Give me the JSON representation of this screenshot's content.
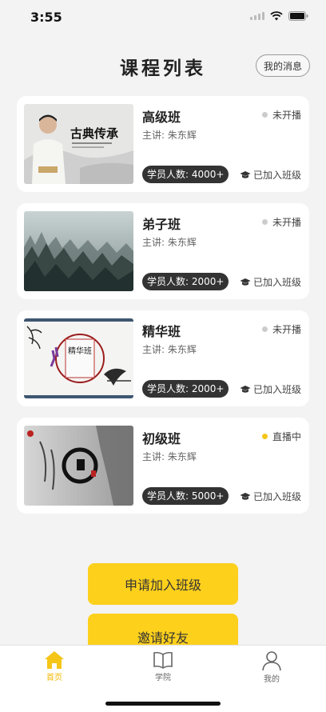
{
  "status_bar": {
    "time": "3:55"
  },
  "header": {
    "title": "课程列表",
    "messages_label": "我的消息"
  },
  "courses": [
    {
      "name": "高级班",
      "teacher": "主讲: 朱东辉",
      "status": "未开播",
      "live": false,
      "students": "学员人数: 4000+",
      "joined": "已加入班级",
      "thumb_caption": "古典传承"
    },
    {
      "name": "弟子班",
      "teacher": "主讲: 朱东辉",
      "status": "未开播",
      "live": false,
      "students": "学员人数: 2000+",
      "joined": "已加入班级"
    },
    {
      "name": "精华班",
      "teacher": "主讲: 朱东辉",
      "status": "未开播",
      "live": false,
      "students": "学员人数: 2000+",
      "joined": "已加入班级",
      "thumb_caption": "精华班"
    },
    {
      "name": "初级班",
      "teacher": "主讲: 朱东辉",
      "status": "直播中",
      "live": true,
      "students": "学员人数: 5000+",
      "joined": "已加入班级"
    }
  ],
  "actions": {
    "apply_label": "申请加入班级",
    "invite_label": "邀请好友"
  },
  "tabs": [
    {
      "label": "首页",
      "icon": "home-icon",
      "active": true
    },
    {
      "label": "学院",
      "icon": "book-icon",
      "active": false
    },
    {
      "label": "我的",
      "icon": "person-icon",
      "active": false
    }
  ],
  "colors": {
    "accent": "#fdd01c",
    "live_dot": "#f5c518",
    "idle_dot": "#cccccc",
    "pill": "#333333"
  }
}
